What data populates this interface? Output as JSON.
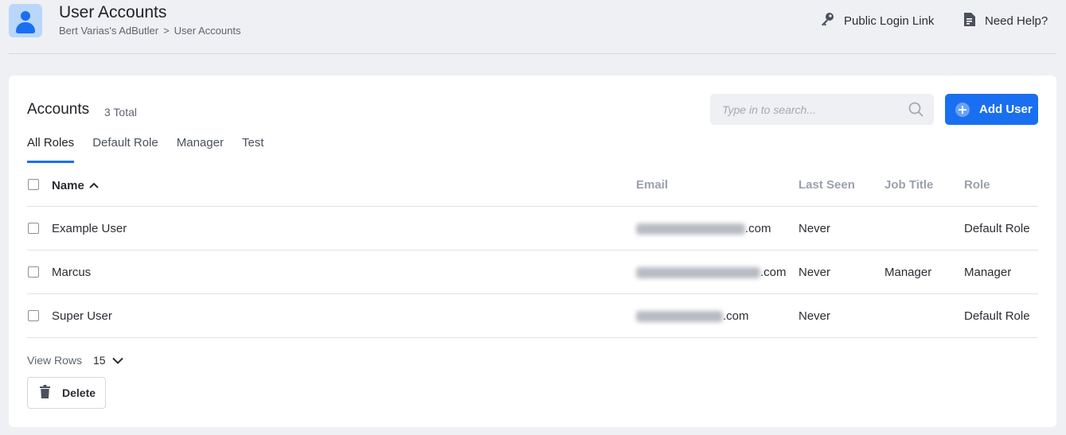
{
  "header": {
    "title": "User Accounts",
    "breadcrumb": [
      "Bert Varias's AdButler",
      "User Accounts"
    ],
    "breadcrumb_sep": ">",
    "public_login_link": "Public Login Link",
    "need_help": "Need Help?"
  },
  "accounts": {
    "title": "Accounts",
    "total": "3 Total",
    "search_placeholder": "Type in to search...",
    "add_user_label": "Add User",
    "tabs": [
      "All Roles",
      "Default Role",
      "Manager",
      "Test"
    ],
    "active_tab": "All Roles"
  },
  "table": {
    "columns": {
      "name": "Name",
      "email": "Email",
      "last_seen": "Last Seen",
      "job_title": "Job Title",
      "role": "Role"
    },
    "rows": [
      {
        "name": "Example User",
        "email_suffix": ".com",
        "last_seen": "Never",
        "job_title": "",
        "role": "Default Role"
      },
      {
        "name": "Marcus",
        "email_suffix": ".com",
        "last_seen": "Never",
        "job_title": "Manager",
        "role": "Manager"
      },
      {
        "name": "Super User",
        "email_suffix": ".com",
        "last_seen": "Never",
        "job_title": "",
        "role": "Default Role"
      }
    ]
  },
  "footer": {
    "view_rows_label": "View Rows",
    "view_rows_value": "15",
    "delete_label": "Delete"
  },
  "colors": {
    "accent": "#1a6ff0",
    "background": "#eff0f3",
    "card": "#ffffff"
  },
  "icons": [
    "user-avatar-icon",
    "key-icon",
    "document-icon",
    "search-icon",
    "plus-circle-icon",
    "chevron-up-icon",
    "chevron-down-icon",
    "trash-icon"
  ]
}
